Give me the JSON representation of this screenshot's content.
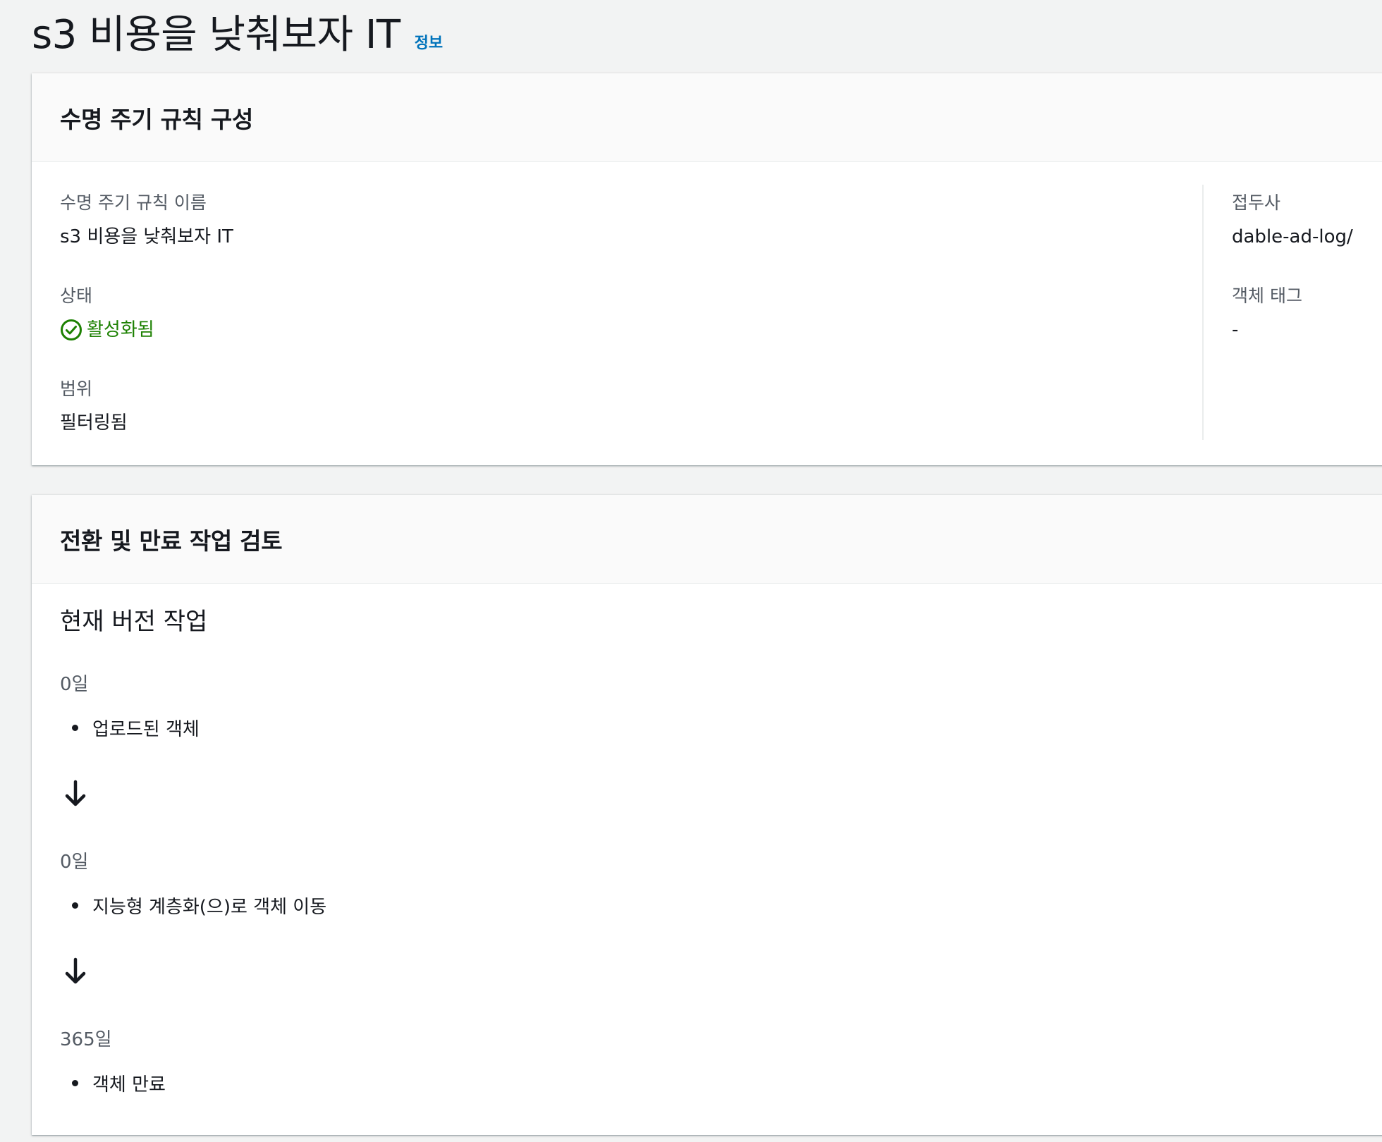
{
  "page": {
    "title": "s3 비용을 낮춰보자 IT",
    "info_link": "정보"
  },
  "config_card": {
    "heading": "수명 주기 규칙 구성",
    "rule_name_label": "수명 주기 규칙 이름",
    "rule_name_value": "s3 비용을 낮춰보자 IT",
    "status_label": "상태",
    "status_value": "활성화됨",
    "scope_label": "범위",
    "scope_value": "필터링됨",
    "prefix_label": "접두사",
    "prefix_value": "dable-ad-log/",
    "object_tags_label": "객체 태그",
    "object_tags_value": "-",
    "status_color": "#1d8102"
  },
  "review_card": {
    "heading": "전환 및 만료 작업 검토",
    "subtitle": "현재 버전 작업",
    "steps": [
      {
        "day": "0일",
        "action": "업로드된 객체"
      },
      {
        "day": "0일",
        "action": "지능형 계층화(으)로 객체 이동"
      },
      {
        "day": "365일",
        "action": "객체 만료"
      }
    ]
  }
}
